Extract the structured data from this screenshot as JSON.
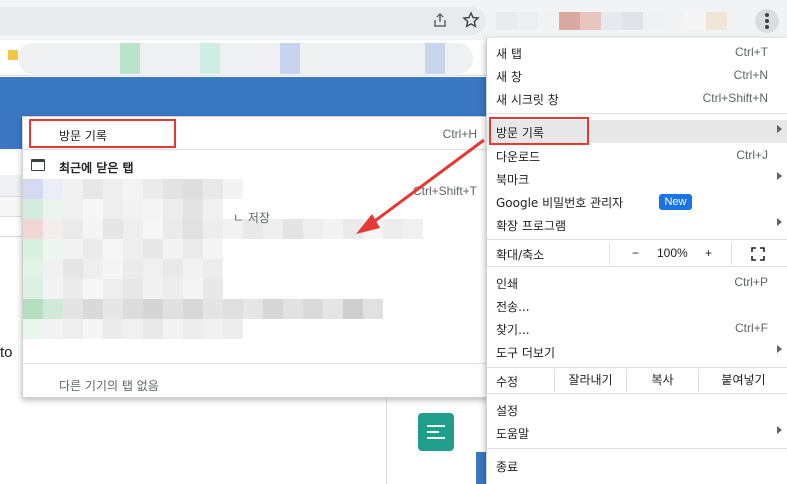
{
  "submenu": {
    "history_title": "방문 기록",
    "history_shortcut": "Ctrl+H",
    "recent_tabs": "최근에 닫은 탭",
    "recent_shortcut": "Ctrl+Shift+T",
    "partial_text": "ㄴ 저장",
    "no_devices": "다른 기기의 탭 없음"
  },
  "page": {
    "side_text": "to"
  },
  "menu": {
    "new_tab": "새 탭",
    "new_tab_kbd": "Ctrl+T",
    "new_window": "새 창",
    "new_window_kbd": "Ctrl+N",
    "incognito": "새 시크릿 창",
    "incognito_kbd": "Ctrl+Shift+N",
    "history": "방문 기록",
    "downloads": "다운로드",
    "downloads_kbd": "Ctrl+J",
    "bookmarks": "북마크",
    "passwords": "Google 비밀번호 관리자",
    "new_badge": "New",
    "extensions": "확장 프로그램",
    "zoom_label": "확대/축소",
    "zoom_minus": "−",
    "zoom_value": "100%",
    "zoom_plus": "+",
    "print": "인쇄",
    "print_kbd": "Ctrl+P",
    "cast": "전송...",
    "find": "찾기...",
    "find_kbd": "Ctrl+F",
    "more_tools": "도구 더보기",
    "edit_label": "수정",
    "cut": "잘라내기",
    "copy": "복사",
    "paste": "붙여넣기",
    "settings": "설정",
    "help": "도움말",
    "exit": "종료"
  },
  "colors": {
    "accent_red": "#e53935",
    "banner_blue": "#3a78c3",
    "badge_blue": "#1a73e8",
    "teal_button": "#1f9e8a"
  },
  "icons": {
    "share": "share-icon",
    "star": "bookmark-star-icon",
    "menu": "more-vert-icon",
    "tab": "tab-icon",
    "fullscreen": "fullscreen-icon",
    "list": "list-icon"
  }
}
